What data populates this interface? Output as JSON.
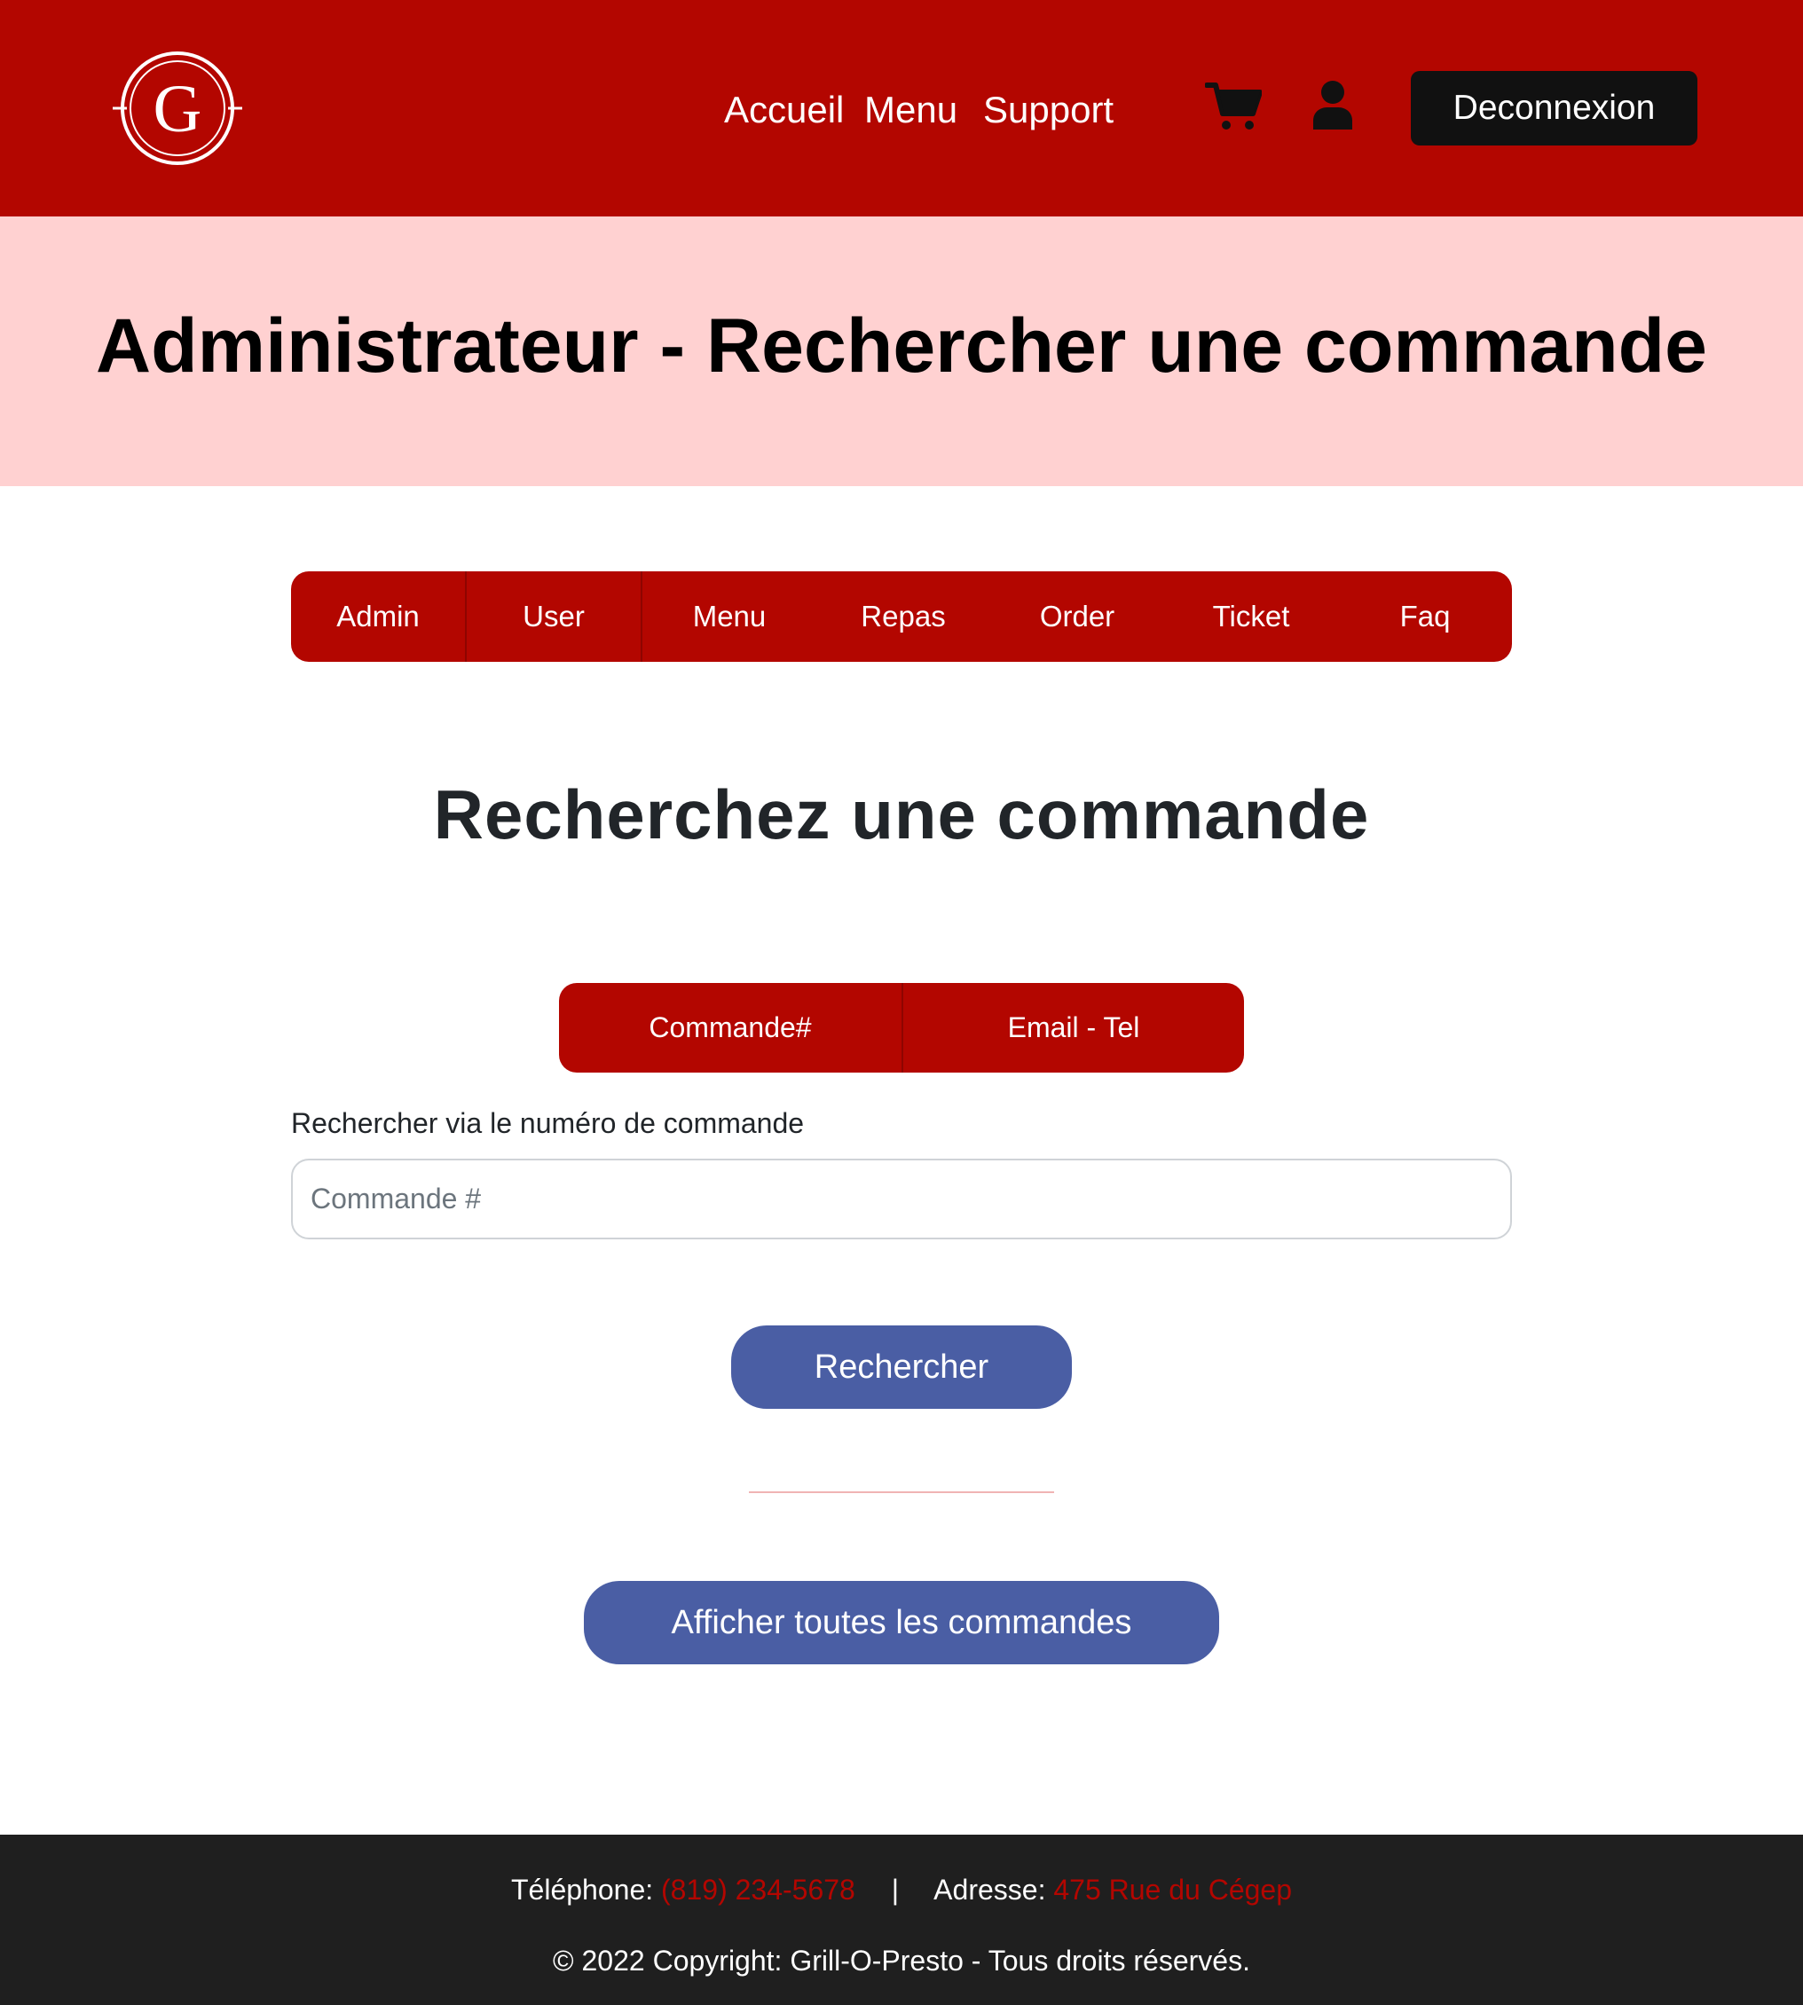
{
  "header": {
    "logo_letter": "G",
    "nav": [
      "Accueil",
      "Menu",
      "Support"
    ],
    "cart_icon": "cart-icon",
    "user_icon": "user-icon",
    "logout_label": "Deconnexion"
  },
  "hero": {
    "title": "Administrateur - Rechercher une commande"
  },
  "admin_tabs": [
    "Admin",
    "User",
    "Menu",
    "Repas",
    "Order",
    "Ticket",
    "Faq"
  ],
  "search": {
    "title": "Recherchez une commande",
    "modes": [
      "Commande#",
      "Email - Tel"
    ],
    "label": "Rechercher via le numéro de commande",
    "input_value": "",
    "input_placeholder": "Commande #",
    "search_button": "Rechercher",
    "show_all_button": "Afficher toutes les commandes"
  },
  "footer": {
    "phone_label": "Téléphone:",
    "phone_value": "(819) 234-5678",
    "separator": "|",
    "address_label": "Adresse:",
    "address_value": "475 Rue du Cégep",
    "copyright": "© 2022 Copyright: Grill-O-Presto - Tous droits réservés."
  },
  "colors": {
    "brand_red": "#b30600",
    "hero_pink": "#ffd1d1",
    "button_blue": "#4a5ea4",
    "footer_dark": "#1f1f1f"
  }
}
